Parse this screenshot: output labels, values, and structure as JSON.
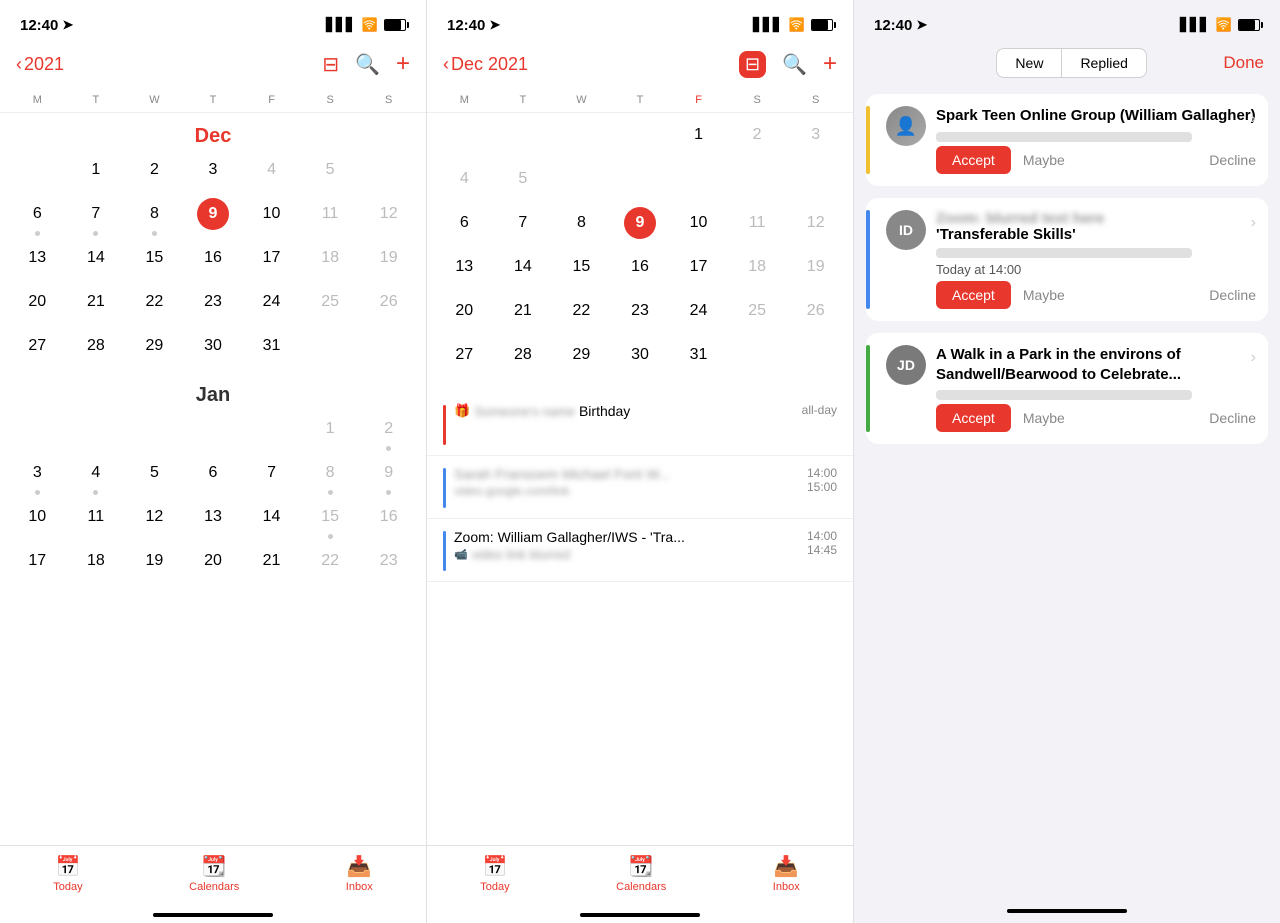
{
  "panel1": {
    "statusTime": "12:40",
    "year": "2021",
    "navItems": [
      "calendar-icon",
      "search-icon",
      "add-icon"
    ],
    "dayLetters": [
      "M",
      "T",
      "W",
      "T",
      "F",
      "S",
      "S"
    ],
    "months": [
      {
        "label": "Dec",
        "labelColor": "red",
        "weeks": [
          [
            null,
            null,
            null,
            null,
            null,
            null,
            null
          ],
          [
            1,
            2,
            3,
            4,
            5,
            null,
            null
          ],
          [
            6,
            7,
            8,
            9,
            10,
            11,
            12
          ],
          [
            13,
            14,
            15,
            16,
            17,
            18,
            19
          ],
          [
            20,
            21,
            22,
            23,
            24,
            25,
            26
          ],
          [
            27,
            28,
            29,
            30,
            31,
            null,
            null
          ]
        ]
      },
      {
        "label": "Jan",
        "labelColor": "gray",
        "weeks": [
          [
            null,
            null,
            null,
            null,
            null,
            1,
            2
          ],
          [
            3,
            4,
            5,
            6,
            7,
            8,
            9
          ],
          [
            10,
            11,
            12,
            13,
            14,
            15,
            16
          ],
          [
            17,
            18,
            19,
            20,
            21,
            22,
            23
          ]
        ]
      }
    ],
    "today": 9,
    "todayMonth": "Dec",
    "tabs": [
      "Today",
      "Calendars",
      "Inbox"
    ]
  },
  "panel2": {
    "statusTime": "12:40",
    "navTitle": "Dec 2021",
    "dayLetters": [
      "M",
      "T",
      "W",
      "T",
      "F",
      "S",
      "S"
    ],
    "weeks": [
      [
        null,
        null,
        null,
        null,
        1,
        2,
        3,
        4,
        5
      ],
      [
        6,
        7,
        8,
        9,
        10,
        11,
        12,
        null,
        null
      ],
      [
        13,
        14,
        15,
        16,
        17,
        18,
        19,
        null,
        null
      ],
      [
        20,
        21,
        22,
        23,
        24,
        25,
        26,
        null,
        null
      ],
      [
        27,
        28,
        29,
        30,
        31,
        null,
        null,
        null,
        null
      ]
    ],
    "today": 9,
    "events": [
      {
        "color": "#e8372c",
        "hasGift": true,
        "title": "Birthday",
        "subtitle": "blurred",
        "timeTop": "all-day",
        "timeBottom": ""
      },
      {
        "color": "#4488ee",
        "hasGift": false,
        "title": "blurred",
        "subtitle": "blurred",
        "timeTop": "14:00",
        "timeBottom": "15:00"
      },
      {
        "color": "#4488ee",
        "hasGift": false,
        "title": "Zoom: William Gallagher/IWS - 'Tra...",
        "subtitle": "blurred",
        "timeTop": "14:00",
        "timeBottom": "14:45"
      }
    ],
    "tabs": [
      "Today",
      "Calendars",
      "Inbox"
    ]
  },
  "panel3": {
    "statusTime": "12:40",
    "filterNew": "New",
    "filterReplied": "Replied",
    "doneBtn": "Done",
    "invites": [
      {
        "avatarType": "photo",
        "avatarText": "",
        "accentColor": "#f0c030",
        "title": "Spark Teen Online Group (William Gallagher)",
        "subtitle": "blurred",
        "time": "",
        "acceptLabel": "Accept",
        "maybeLabel": "Maybe",
        "declineLabel": "Decline"
      },
      {
        "avatarType": "gray-id",
        "avatarText": "ID",
        "accentColor": "#4488ee",
        "title": "Zoom: 'Transferable Skills'",
        "titleBlurred": "blurred prefix",
        "subtitle": "blurred",
        "time": "Today at 14:00",
        "acceptLabel": "Accept",
        "maybeLabel": "Maybe",
        "declineLabel": "Decline"
      },
      {
        "avatarType": "gray-jd",
        "avatarText": "JD",
        "accentColor": "#44aa44",
        "title": "A Walk in a Park in the environs of Sandwell/Bearwood to Celebrate...",
        "subtitle": "blurred",
        "time": "",
        "acceptLabel": "Accept",
        "maybeLabel": "Maybe",
        "declineLabel": "Decline"
      }
    ]
  }
}
